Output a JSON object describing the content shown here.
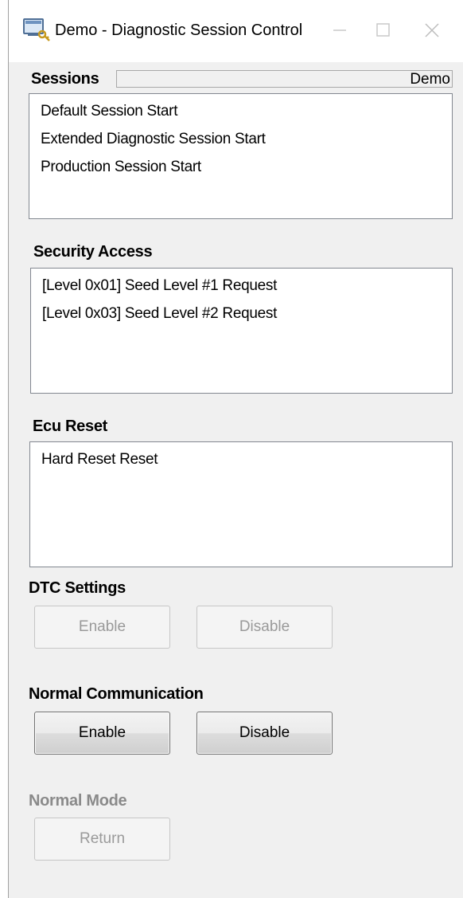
{
  "window": {
    "title": "Demo - Diagnostic Session Control",
    "controls": {
      "minimize": "minimize-icon",
      "maximize": "maximize-icon",
      "close": "close-icon"
    }
  },
  "sessions": {
    "label": "Sessions",
    "tag": "Demo",
    "items": [
      "Default Session Start",
      "Extended Diagnostic Session Start",
      "Production Session Start"
    ]
  },
  "security": {
    "label": "Security Access",
    "items": [
      "[Level 0x01] Seed Level #1 Request",
      "[Level 0x03] Seed Level #2 Request"
    ]
  },
  "ecu_reset": {
    "label": "Ecu Reset",
    "items": [
      "Hard Reset Reset"
    ]
  },
  "dtc": {
    "label": "DTC Settings",
    "enable": "Enable",
    "disable": "Disable"
  },
  "normal_comm": {
    "label": "Normal Communication",
    "enable": "Enable",
    "disable": "Disable"
  },
  "normal_mode": {
    "label": "Normal Mode",
    "return": "Return"
  },
  "colors": {
    "window_bg": "#f0f0f0",
    "disabled_text": "#9a9a9a",
    "list_border": "#828790"
  }
}
